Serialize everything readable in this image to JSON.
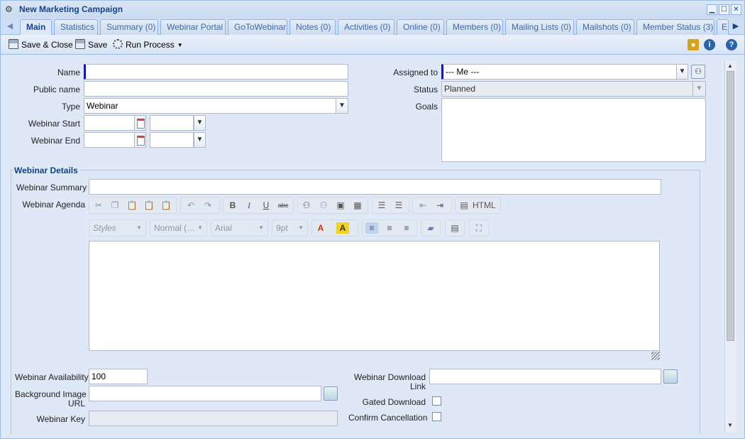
{
  "window": {
    "title": "New Marketing Campaign",
    "controls": {
      "minimize": "▁",
      "maximize": "☐",
      "close": "✕"
    }
  },
  "tabs": [
    {
      "label": "Main",
      "active": true
    },
    {
      "label": "Statistics"
    },
    {
      "label": "Summary (0)"
    },
    {
      "label": "Webinar Portal"
    },
    {
      "label": "GoToWebinar"
    },
    {
      "label": "Notes (0)"
    },
    {
      "label": "Activities (0)"
    },
    {
      "label": "Online (0)"
    },
    {
      "label": "Members (0)"
    },
    {
      "label": "Mailing Lists (0)"
    },
    {
      "label": "Mailshots (0)"
    },
    {
      "label": "Member Status (3)"
    },
    {
      "label": "E"
    }
  ],
  "toolbar": {
    "save_close": "Save & Close",
    "save": "Save",
    "run_process": "Run Process",
    "info_icon": "i",
    "help_icon": "?"
  },
  "form": {
    "name_label": "Name",
    "name_value": "",
    "public_name_label": "Public name",
    "public_name_value": "",
    "type_label": "Type",
    "type_value": "Webinar",
    "webinar_start_label": "Webinar Start",
    "webinar_end_label": "Webinar End",
    "assigned_to_label": "Assigned to",
    "assigned_to_value": "--- Me ---",
    "status_label": "Status",
    "status_value": "Planned",
    "goals_label": "Goals"
  },
  "webinar": {
    "section_title": "Webinar Details",
    "summary_label": "Webinar Summary",
    "agenda_label": "Webinar Agenda",
    "editor": {
      "html_label": "HTML",
      "styles_placeholder": "Styles",
      "format_value": "Normal (…",
      "font_value": "Arial",
      "size_value": "9pt"
    },
    "availability_label": "Webinar Availability",
    "availability_value": "100",
    "background_image_label_1": "Background Image",
    "background_image_label_2": "URL",
    "webinar_key_label": "Webinar Key",
    "download_link_label_1": "Webinar Download",
    "download_link_label_2": "Link",
    "gated_download_label": "Gated Download",
    "confirm_cancellation_label": "Confirm Cancellation"
  }
}
